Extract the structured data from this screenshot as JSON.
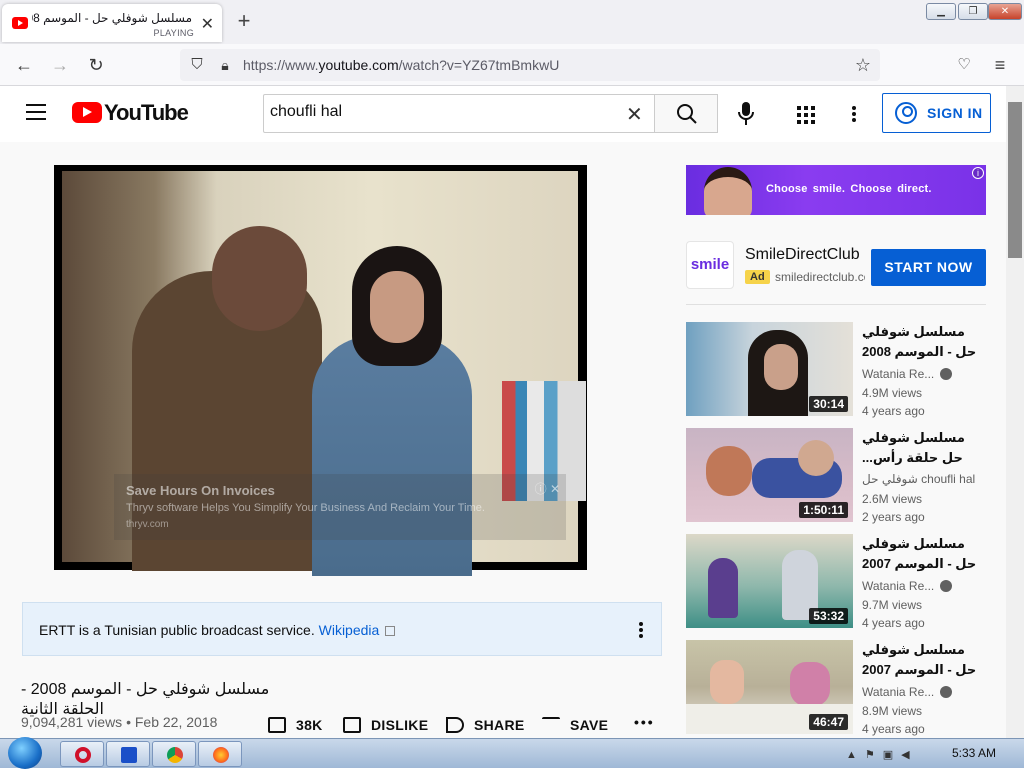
{
  "browser": {
    "tab_title": "مسلسل شوفلي حل - الموسم 2008 -",
    "tab_status": "PLAYING",
    "new_tab": "+",
    "url_prefix": "https://www.",
    "url_domain": "youtube.com",
    "url_path": "/watch?v=YZ67tmBmkwU",
    "window_buttons": [
      "minimize",
      "maximize",
      "close"
    ]
  },
  "header": {
    "logo": "YouTube",
    "search_value": "choufli hal",
    "sign_in": "SIGN IN"
  },
  "player": {
    "ad_title": "Save Hours On Invoices",
    "ad_desc": "Thryv software Helps You Simplify Your Business And Reclaim Your Time.",
    "ad_domain": "thryv.com"
  },
  "info_panel": {
    "text": "ERTT is a Tunisian public broadcast service.",
    "link": "Wikipedia"
  },
  "video": {
    "title": "مسلسل شوفلي حل - الموسم 2008 - الحلقة الثانية",
    "views": "9,094,281 views",
    "date": "Feb 22, 2018",
    "separator": "•",
    "likes": "38K",
    "dislike": "DISLIKE",
    "share": "SHARE",
    "save": "SAVE"
  },
  "sidebar_ad": {
    "banner_text": "Choose smile.  Choose direct.",
    "logo": "smile",
    "name": "SmileDirectClub",
    "tag": "Ad",
    "domain": "smiledirectclub.com",
    "cta": "START NOW"
  },
  "recommendations": [
    {
      "title": "مسلسل شوفلي حل - الموسم 2008 ...",
      "channel": "Watania Re...",
      "verified": true,
      "views": "4.9M views",
      "age": "4 years ago",
      "duration": "30:14"
    },
    {
      "title": "مسلسل شوفلي حل حلقة رأس...",
      "channel": "شوفلي حل choufli hal",
      "verified": false,
      "views": "2.6M views",
      "age": "2 years ago",
      "duration": "1:50:11"
    },
    {
      "title": "مسلسل شوفلي حل - الموسم 2007 ...",
      "channel": "Watania Re...",
      "verified": true,
      "views": "9.7M views",
      "age": "4 years ago",
      "duration": "53:32"
    },
    {
      "title": "مسلسل شوفلي حل - الموسم 2007 ...",
      "channel": "Watania Re...",
      "verified": true,
      "views": "8.9M views",
      "age": "4 years ago",
      "duration": "46:47"
    }
  ],
  "taskbar": {
    "apps": [
      "opera-icon",
      "malwarebytes-icon",
      "chrome-icon",
      "firefox-icon"
    ],
    "clock": "5:33 AM"
  },
  "colors": {
    "youtube_red": "#ff0000",
    "link_blue": "#065fd4",
    "ad_purple": "#6a2de0"
  }
}
